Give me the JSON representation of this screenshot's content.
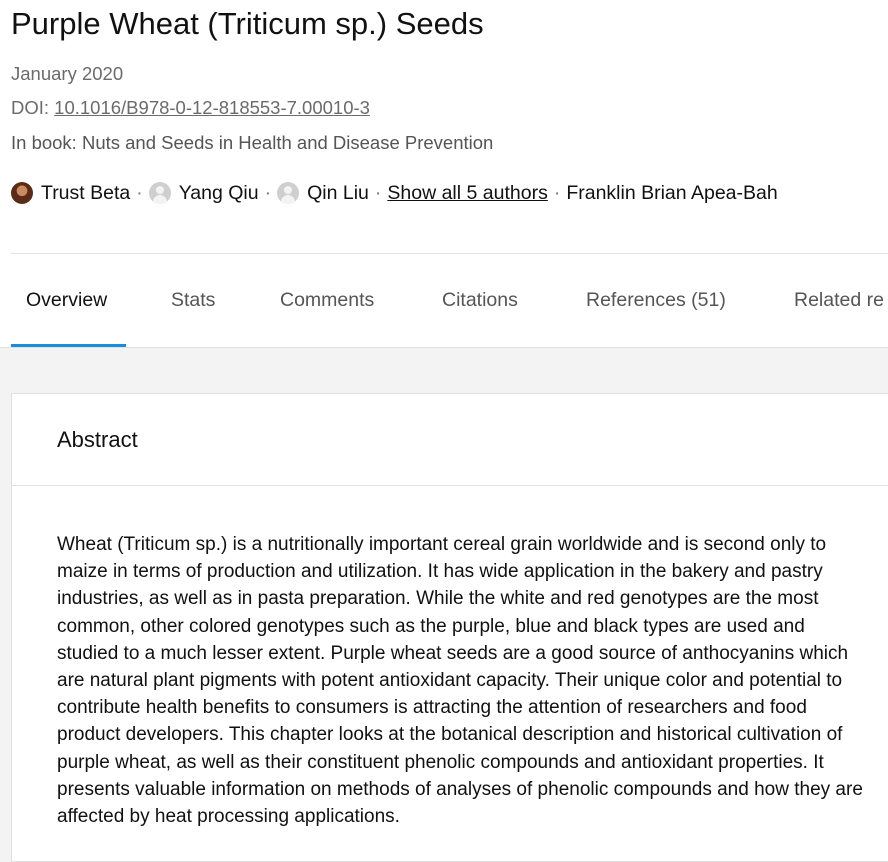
{
  "publication": {
    "title": "Purple Wheat (Triticum sp.) Seeds",
    "date": "January 2020",
    "doi_label": "DOI: ",
    "doi": "10.1016/B978-0-12-818553-7.00010-3",
    "book": "In book: Nuts and Seeds in Health and Disease Prevention"
  },
  "authors": {
    "list": [
      "Trust Beta",
      "Yang Qiu",
      "Qin Liu",
      "Franklin Brian Apea-Bah"
    ],
    "separator": "·",
    "show_all": "Show all 5 authors"
  },
  "tabs": [
    {
      "label": "Overview",
      "active": true
    },
    {
      "label": "Stats"
    },
    {
      "label": "Comments"
    },
    {
      "label": "Citations"
    },
    {
      "label": "References (51)"
    },
    {
      "label": "Related re"
    }
  ],
  "abstract": {
    "heading": "Abstract",
    "text": "Wheat (Triticum sp.) is a nutritionally important cereal grain worldwide and is second only to maize in terms of production and utilization. It has wide application in the bakery and pastry industries, as well as in pasta preparation. While the white and red genotypes are the most common, other colored genotypes such as the purple, blue and black types are used and studied to a much lesser extent. Purple wheat seeds are a good source of anthocyanins which are natural plant pigments with potent antioxidant capacity. Their unique color and potential to contribute health benefits to consumers is attracting the attention of researchers and food product developers. This chapter looks at the botanical description and historical cultivation of purple wheat, as well as their constituent phenolic compounds and antioxidant properties. It presents valuable information on methods of analyses of phenolic compounds and how they are affected by heat processing applications."
  },
  "colors": {
    "accent": "#1a8cd8",
    "background": "#f3f3f3"
  }
}
